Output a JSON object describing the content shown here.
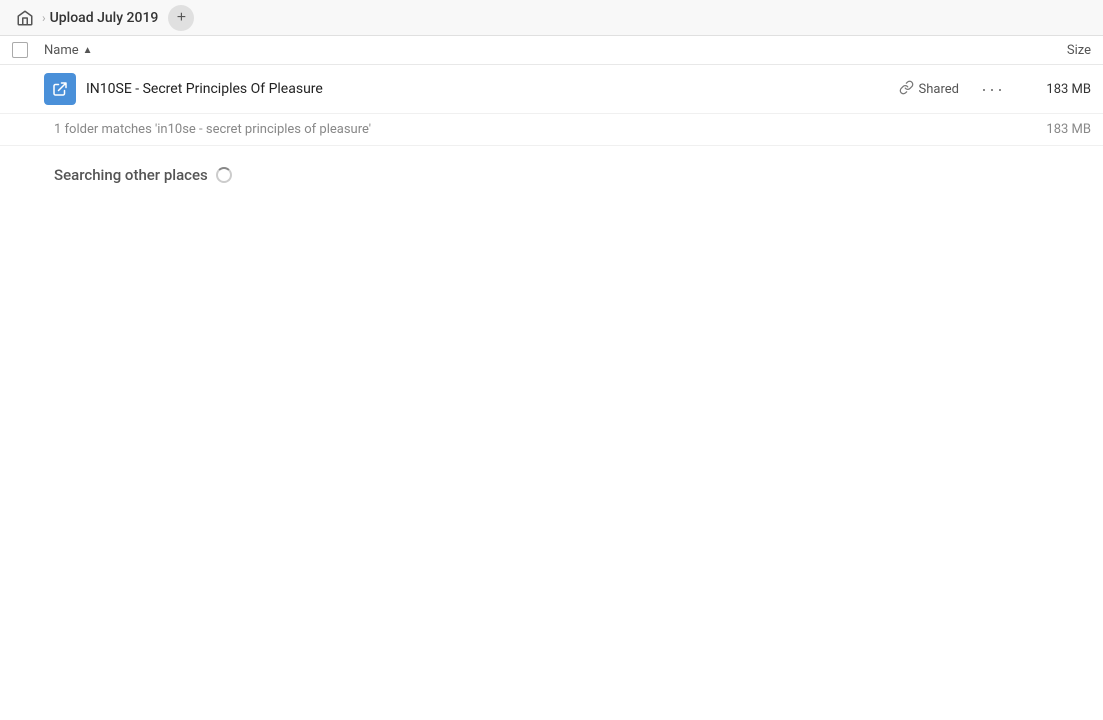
{
  "header": {
    "home_icon": "home-icon",
    "breadcrumb_separator": "›",
    "breadcrumb_text": "Upload July 2019",
    "add_button_label": "+"
  },
  "columns": {
    "name_label": "Name",
    "sort_arrow": "▲",
    "size_label": "Size"
  },
  "file_row": {
    "icon_type": "folder-link-icon",
    "name": "IN10SE - Secret Principles Of Pleasure",
    "shared_label": "Shared",
    "more_label": "···",
    "size": "183 MB"
  },
  "search_results": {
    "match_text": "1 folder matches 'in10se - secret principles of pleasure'",
    "size": "183 MB"
  },
  "searching": {
    "label": "Searching other places"
  }
}
